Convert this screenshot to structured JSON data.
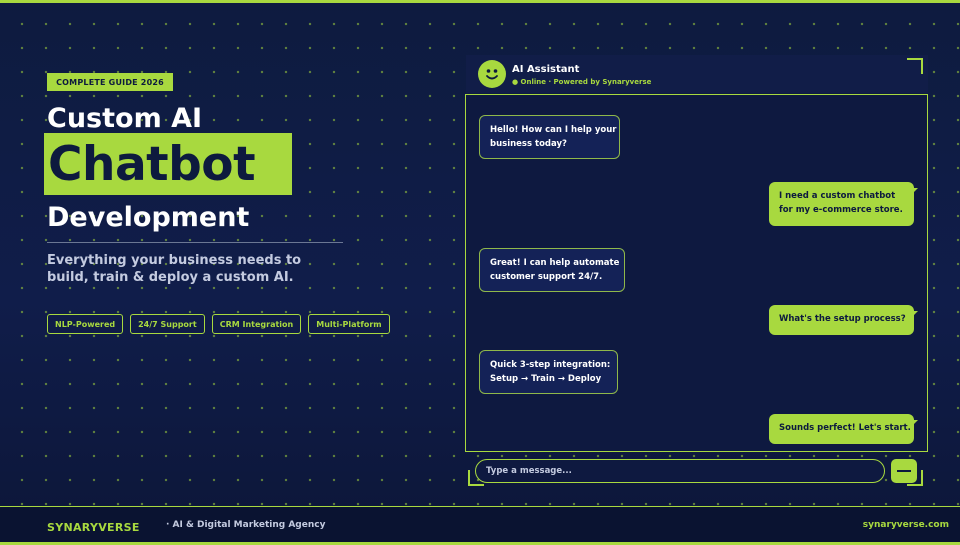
{
  "hero": {
    "badge": "COMPLETE GUIDE 2026",
    "title_line1": "Custom AI",
    "title_line2": "Chatbot",
    "title_line3": "Development",
    "subtitle_line1": "Everything your business needs to",
    "subtitle_line2": "build, train & deploy a custom AI.",
    "chips": [
      "NLP-Powered",
      "24/7 Support",
      "CRM Integration",
      "Multi-Platform"
    ]
  },
  "chat": {
    "assistant_name": "AI Assistant",
    "status": "● Online · Powered by Synaryverse",
    "messages": [
      {
        "from": "bot",
        "line1": "Hello! How can I help your",
        "line2": "business today?"
      },
      {
        "from": "user",
        "line1": "I need a custom chatbot",
        "line2": "for my e-commerce store."
      },
      {
        "from": "bot",
        "line1": "Great! I can help automate",
        "line2": "customer support 24/7."
      },
      {
        "from": "user",
        "line1": "What's the setup process?"
      },
      {
        "from": "bot",
        "line1": "Quick 3-step integration:",
        "line2": "Setup → Train → Deploy"
      },
      {
        "from": "user",
        "line1": "Sounds perfect! Let's start."
      }
    ],
    "input_placeholder": "Type a message...",
    "send_icon": "send-icon"
  },
  "footer": {
    "brand": "SYNARYVERSE",
    "tagline": "· AI & Digital Marketing Agency",
    "website": "synaryverse.com"
  },
  "colors": {
    "accent": "#a8d93f",
    "background": "#0d1a3e"
  }
}
